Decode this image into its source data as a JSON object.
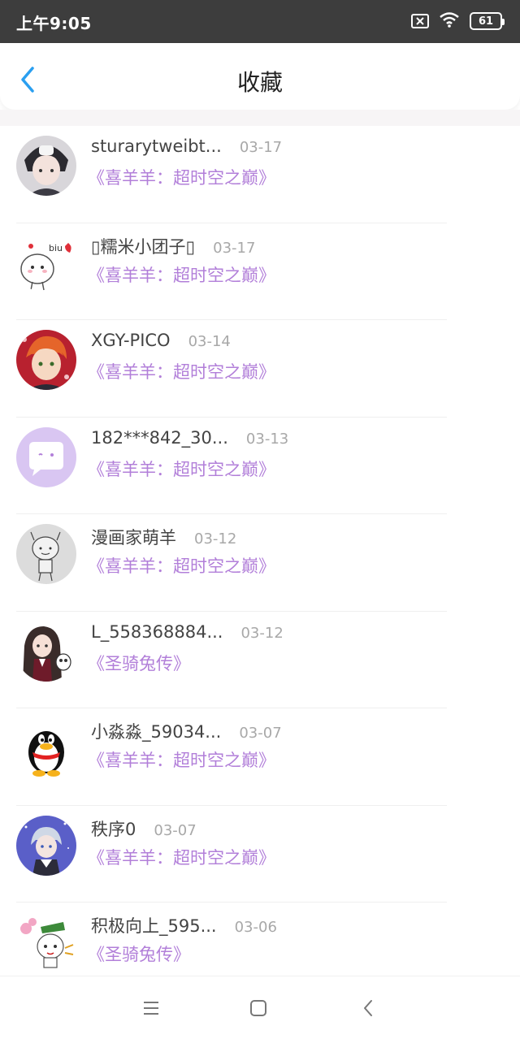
{
  "status_bar": {
    "time": "上午9:05",
    "battery": "61"
  },
  "header": {
    "title": "收藏"
  },
  "items": [
    {
      "username": "sturarytweibt...",
      "date": "03-17",
      "work": "《喜羊羊：超时空之巅》",
      "avatar": "anime-boy-avatar"
    },
    {
      "username": "▯糯米小团子▯",
      "date": "03-17",
      "work": "《喜羊羊：超时空之巅》",
      "avatar": "cute-blob-avatar"
    },
    {
      "username": "XGY-PICO",
      "date": "03-14",
      "work": "《喜羊羊：超时空之巅》",
      "avatar": "red-hair-avatar"
    },
    {
      "username": "182***842_30...",
      "date": "03-13",
      "work": "《喜羊羊：超时空之巅》",
      "avatar": "default-chat-avatar"
    },
    {
      "username": "漫画家萌羊",
      "date": "03-12",
      "work": "《喜羊羊：超时空之巅》",
      "avatar": "sketch-sheep-avatar"
    },
    {
      "username": "L_558368884...",
      "date": "03-12",
      "work": "《圣骑兔传》",
      "avatar": "anime-girl-avatar"
    },
    {
      "username": "小淼淼_59034...",
      "date": "03-07",
      "work": "《喜羊羊：超时空之巅》",
      "avatar": "penguin-avatar"
    },
    {
      "username": "秩序0",
      "date": "03-07",
      "work": "《喜羊羊：超时空之巅》",
      "avatar": "night-anime-avatar"
    },
    {
      "username": "积极向上_595...",
      "date": "03-06",
      "work": "《圣骑兔传》",
      "avatar": "cartoon-animal-avatar"
    }
  ],
  "nav_bar": {
    "icons": [
      "menu-icon",
      "home-icon",
      "back-icon"
    ]
  },
  "colors": {
    "accent": "#b27fd9",
    "back_arrow": "#2a9ff0",
    "status_bar": "#3d3d3d"
  }
}
